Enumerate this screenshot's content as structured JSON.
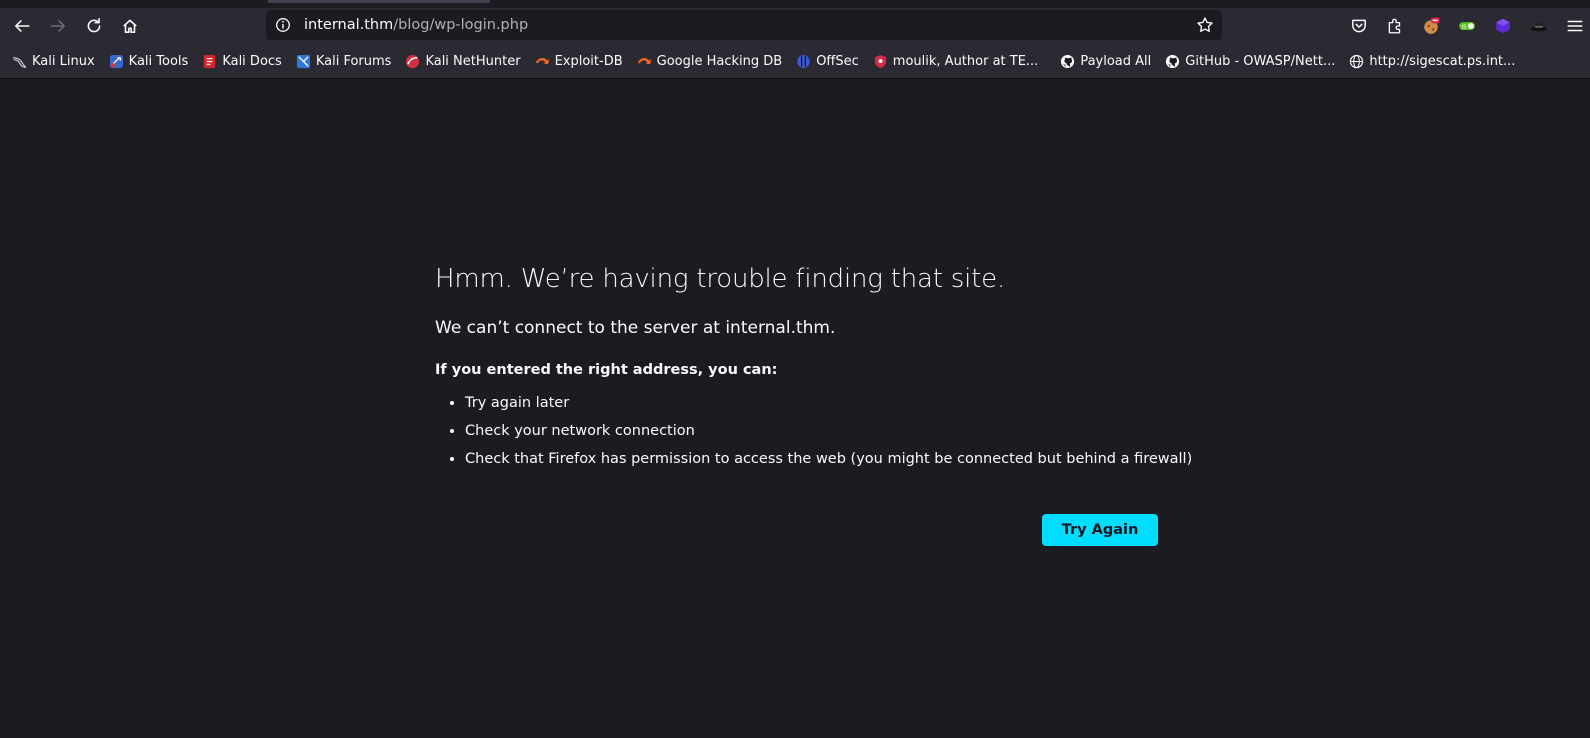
{
  "toolbar": {
    "url_host": "internal.thm",
    "url_path": "/blog/wp-login.php"
  },
  "bookmarks": [
    {
      "label": "Kali Linux",
      "icon": "kali-dragon-icon"
    },
    {
      "label": "Kali Tools",
      "icon": "kali-tools-icon"
    },
    {
      "label": "Kali Docs",
      "icon": "kali-docs-icon"
    },
    {
      "label": "Kali Forums",
      "icon": "kali-forums-icon"
    },
    {
      "label": "Kali NetHunter",
      "icon": "nethunter-icon"
    },
    {
      "label": "Exploit-DB",
      "icon": "exploit-db-icon"
    },
    {
      "label": "Google Hacking DB",
      "icon": "ghdb-icon"
    },
    {
      "label": "OffSec",
      "icon": "offsec-icon"
    },
    {
      "label": "moulik, Author at TE...",
      "icon": "site-icon"
    },
    {
      "label": "Payload All",
      "icon": "github-icon"
    },
    {
      "label": "GitHub - OWASP/Nett...",
      "icon": "github-icon"
    },
    {
      "label": "http://sigescat.ps.int...",
      "icon": "globe-icon"
    }
  ],
  "error": {
    "title": "Hmm. We’re having trouble finding that site.",
    "description": "We can’t connect to the server at internal.thm.",
    "subheading": "If you entered the right address, you can:",
    "items": [
      "Try again later",
      "Check your network connection",
      "Check that Firefox has permission to access the web (you might be connected but behind a firewall)"
    ],
    "button_label": "Try Again"
  },
  "colors": {
    "background": "#1c1b22",
    "toolbar": "#2b2a33",
    "accent": "#00ddff"
  }
}
